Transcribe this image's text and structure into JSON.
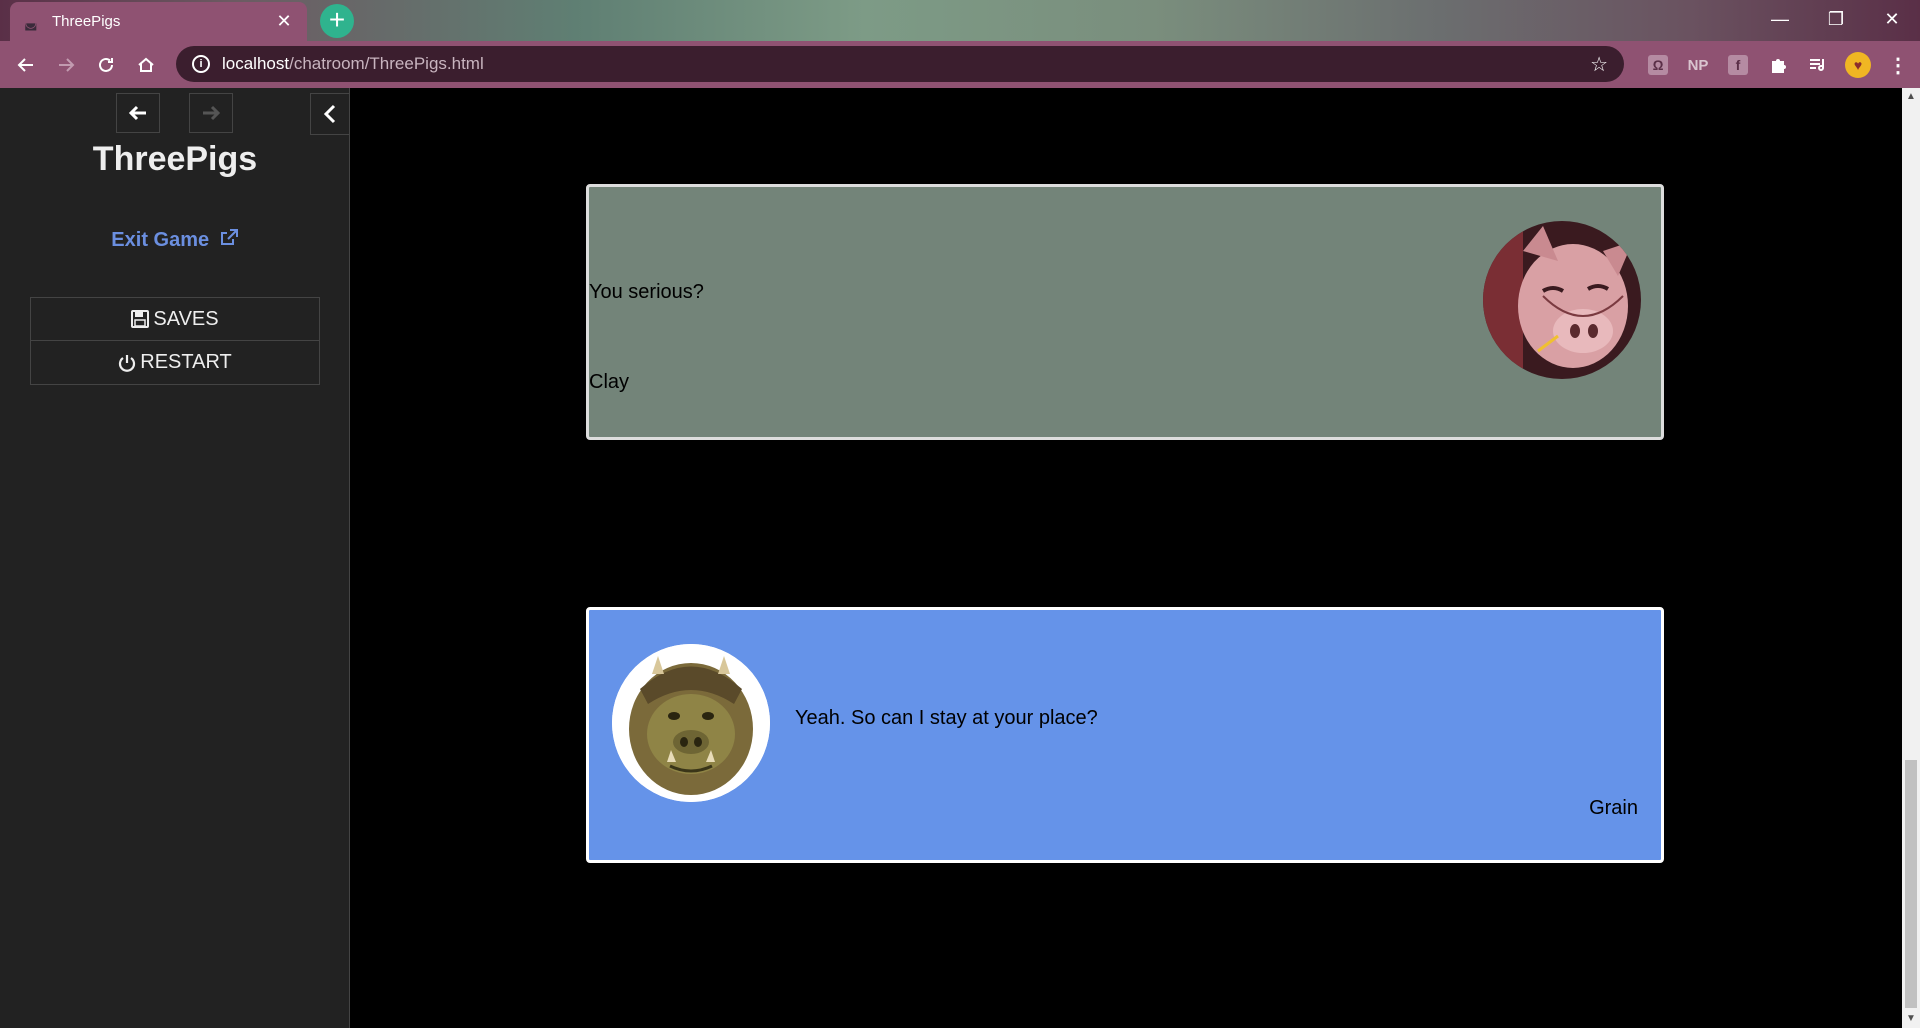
{
  "browser": {
    "tab_title": "ThreePigs",
    "url_host": "localhost",
    "url_path": "/chatroom/ThreePigs.html",
    "extensions": [
      "NP"
    ]
  },
  "sidebar": {
    "title": "ThreePigs",
    "exit_label": "Exit Game",
    "menu": [
      {
        "label": "SAVES",
        "icon": "floppy-disk-icon"
      },
      {
        "label": "RESTART",
        "icon": "power-icon"
      }
    ]
  },
  "messages": [
    {
      "text": "You serious?",
      "speaker": "Clay",
      "color": "#738479",
      "portrait": "pig-portrait"
    },
    {
      "text": "Yeah. So can I stay at your place?",
      "speaker": "Grain",
      "color": "#6593e9",
      "portrait": "gamorrean-portrait"
    }
  ],
  "colors": {
    "accent_link": "#6b8fe0",
    "browser_theme": "#8f5272"
  }
}
